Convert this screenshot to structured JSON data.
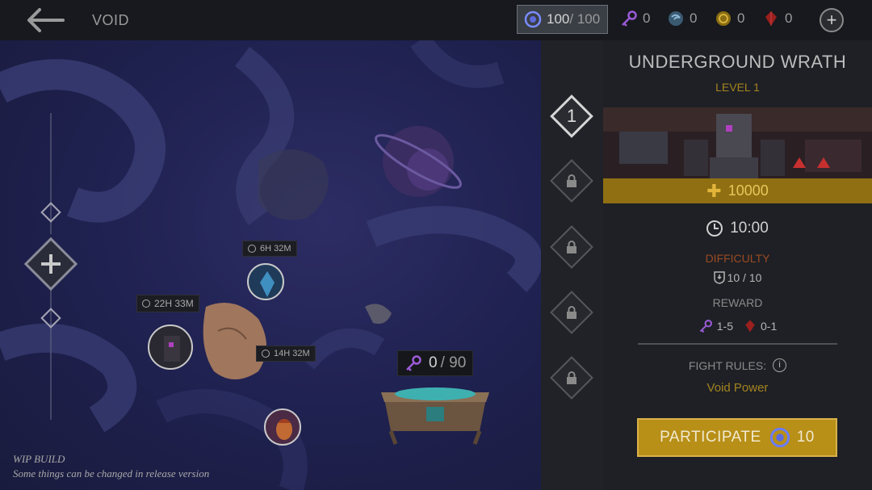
{
  "header": {
    "title": "VOID",
    "energy": {
      "value": "100",
      "max": "/ 100"
    },
    "resources": [
      {
        "name": "key",
        "value": "0"
      },
      {
        "name": "void-orb",
        "value": "0"
      },
      {
        "name": "coin",
        "value": "0"
      },
      {
        "name": "gem",
        "value": "0"
      }
    ]
  },
  "map": {
    "timers": [
      "6H 32M",
      "22H 33M",
      "14H 32M"
    ],
    "keys": {
      "value": "0",
      "max": "/ 90"
    },
    "wip": {
      "line1": "WIP BUILD",
      "line2": "Some things can be changed in release version"
    }
  },
  "levels": [
    {
      "label": "1",
      "state": "active"
    },
    {
      "label": "",
      "state": "locked"
    },
    {
      "label": "",
      "state": "locked"
    },
    {
      "label": "",
      "state": "locked"
    },
    {
      "label": "",
      "state": "locked"
    }
  ],
  "event": {
    "title": "UNDERGROUND WRATH",
    "level": "LEVEL 1",
    "bounty": "10000",
    "timer": "10:00",
    "difficulty_label": "DIFFICULTY",
    "difficulty_value": "10 / 10",
    "reward_label": "REWARD",
    "reward_keys": "1-5",
    "reward_gems": "0-1",
    "rules_label": "FIGHT RULES:",
    "rules_value": "Void Power",
    "participate_label": "PARTICIPATE",
    "participate_cost": "10"
  },
  "colors": {
    "accent_gold": "#b88f17",
    "difficulty": "#9a4a22",
    "map_bg": "#1f2150"
  }
}
